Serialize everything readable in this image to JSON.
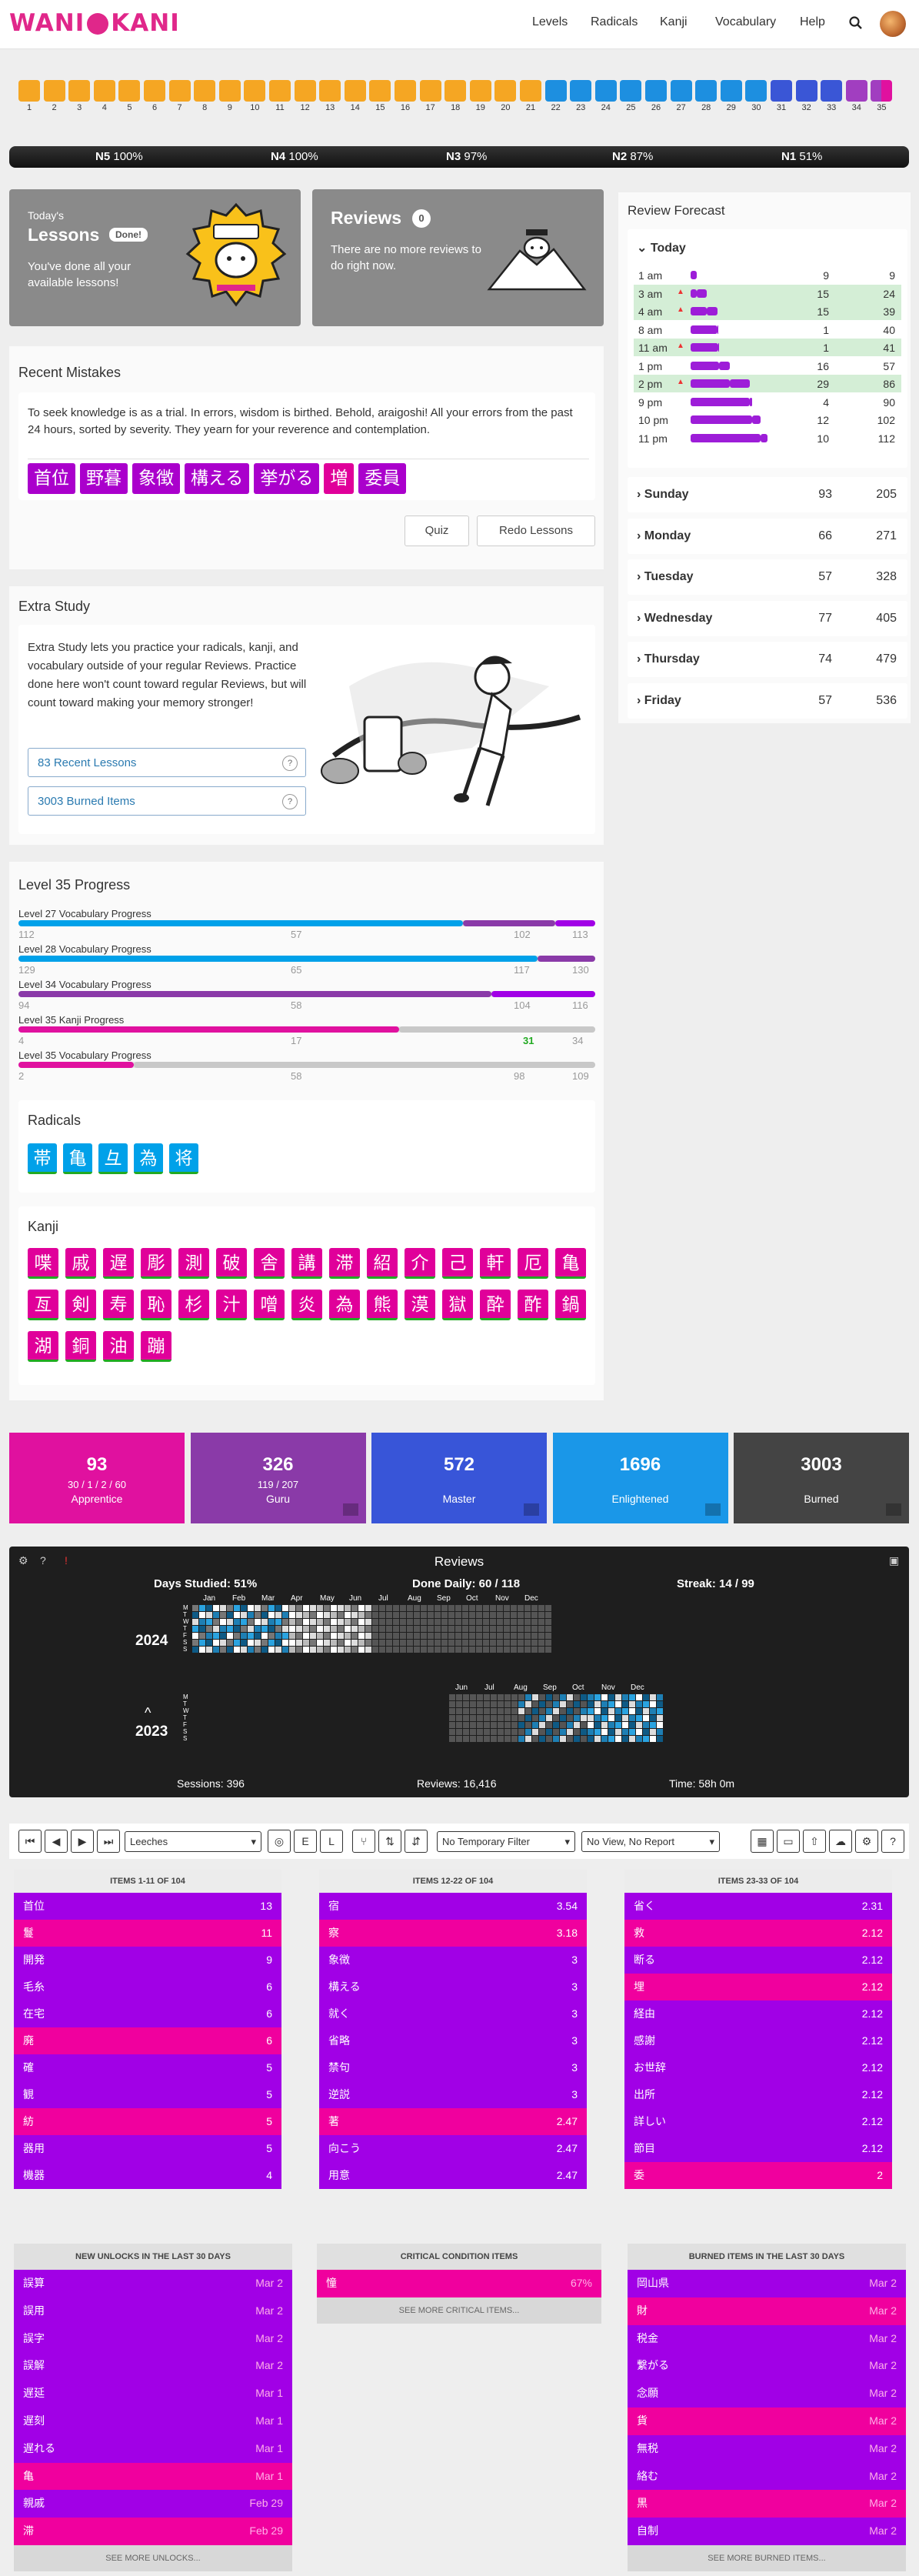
{
  "header": {
    "logo": "WANIKANI",
    "nav": [
      "Levels",
      "Radicals",
      "Kanji",
      "Vocabulary",
      "Help"
    ]
  },
  "levels": {
    "numbers": [
      "1",
      "2",
      "3",
      "4",
      "5",
      "6",
      "7",
      "8",
      "9",
      "10",
      "11",
      "12",
      "13",
      "14",
      "15",
      "16",
      "17",
      "18",
      "19",
      "20",
      "21",
      "22",
      "23",
      "24",
      "25",
      "26",
      "27",
      "28",
      "29",
      "30",
      "31",
      "32",
      "33",
      "34",
      "35"
    ]
  },
  "jlpt": [
    {
      "name": "N5",
      "pct": "100%"
    },
    {
      "name": "N4",
      "pct": "100%"
    },
    {
      "name": "N3",
      "pct": "97%"
    },
    {
      "name": "N2",
      "pct": "87%"
    },
    {
      "name": "N1",
      "pct": "51%"
    }
  ],
  "lessons": {
    "todays": "Today's",
    "title": "Lessons",
    "badge": "Done!",
    "text": "You've done all your available lessons!"
  },
  "reviews": {
    "title": "Reviews",
    "count": "0",
    "text": "There are no more reviews to do right now."
  },
  "mistakes": {
    "title": "Recent Mistakes",
    "text": "To seek knowledge is as a trial. In errors, wisdom is birthed. Behold, araigoshi! All your errors from the past 24 hours, sorted by severity. They yearn for your reverence and contemplation.",
    "items": [
      "首位",
      "野暮",
      "象徴",
      "構える",
      "挙がる",
      "増",
      "委員"
    ],
    "quiz": "Quiz",
    "redo": "Redo Lessons"
  },
  "extra": {
    "title": "Extra Study",
    "text": "Extra Study lets you practice your radicals, kanji, and vocabulary outside of your regular Reviews. Practice done here won't count toward regular Reviews, but will count toward making your memory stronger!",
    "recent": "83 Recent Lessons",
    "burned": "3003 Burned Items",
    "help": "?"
  },
  "progress": {
    "title": "Level 35 Progress",
    "bars": [
      {
        "label": "Level 27 Vocabulary Progress",
        "left": "112",
        "mid": "57",
        "mid2": "102",
        "right": "113"
      },
      {
        "label": "Level 28 Vocabulary Progress",
        "left": "129",
        "mid": "65",
        "mid2": "117",
        "right": "130"
      },
      {
        "label": "Level 34 Vocabulary Progress",
        "left": "94",
        "mid": "58",
        "mid2": "104",
        "right": "116"
      },
      {
        "label": "Level 35 Kanji Progress",
        "left": "4",
        "mid": "17",
        "mid2": "31",
        "right": "34"
      },
      {
        "label": "Level 35 Vocabulary Progress",
        "left": "2",
        "mid": "58",
        "mid2": "98",
        "right": "109"
      }
    ]
  },
  "radicals": {
    "title": "Radicals",
    "items": [
      "帯",
      "亀",
      "彑",
      "為",
      "将"
    ]
  },
  "kanji": {
    "title": "Kanji",
    "items": [
      "喋",
      "戚",
      "遅",
      "彫",
      "測",
      "破",
      "舎",
      "講",
      "滞",
      "紹",
      "介",
      "己",
      "軒",
      "厄",
      "亀",
      "亙",
      "剣",
      "寿",
      "恥",
      "杉",
      "汁",
      "噌",
      "炎",
      "為",
      "熊",
      "漠",
      "獄",
      "酔",
      "酢",
      "鍋",
      "湖",
      "銅",
      "油",
      "蹦"
    ]
  },
  "forecast": {
    "title": "Review Forecast",
    "today": "Today",
    "rows": [
      {
        "t": "1 am",
        "a": "9",
        "b": "9",
        "hl": false
      },
      {
        "t": "3 am",
        "a": "15",
        "b": "24",
        "hl": true
      },
      {
        "t": "4 am",
        "a": "15",
        "b": "39",
        "hl": true
      },
      {
        "t": "8 am",
        "a": "1",
        "b": "40",
        "hl": false
      },
      {
        "t": "11 am",
        "a": "1",
        "b": "41",
        "hl": true
      },
      {
        "t": "1 pm",
        "a": "16",
        "b": "57",
        "hl": false
      },
      {
        "t": "2 pm",
        "a": "29",
        "b": "86",
        "hl": true
      },
      {
        "t": "9 pm",
        "a": "4",
        "b": "90",
        "hl": false
      },
      {
        "t": "10 pm",
        "a": "12",
        "b": "102",
        "hl": false
      },
      {
        "t": "11 pm",
        "a": "10",
        "b": "112",
        "hl": false
      }
    ],
    "days": [
      {
        "d": "Sunday",
        "a": "93",
        "b": "205"
      },
      {
        "d": "Monday",
        "a": "66",
        "b": "271"
      },
      {
        "d": "Tuesday",
        "a": "57",
        "b": "328"
      },
      {
        "d": "Wednesday",
        "a": "77",
        "b": "405"
      },
      {
        "d": "Thursday",
        "a": "74",
        "b": "479"
      },
      {
        "d": "Friday",
        "a": "57",
        "b": "536"
      }
    ]
  },
  "totals": [
    {
      "n": "93",
      "s": "30 / 1 / 2 / 60",
      "l": "Apprentice",
      "color": "#e0119f"
    },
    {
      "n": "326",
      "s": "119 / 207",
      "l": "Guru",
      "color": "#8a3aa8"
    },
    {
      "n": "572",
      "s": "",
      "l": "Master",
      "color": "#3855d8"
    },
    {
      "n": "1696",
      "s": "",
      "l": "Enlightened",
      "color": "#1a97e8"
    },
    {
      "n": "3003",
      "s": "",
      "l": "Burned",
      "color": "#444444"
    }
  ],
  "heatmap": {
    "title": "Reviews",
    "days_studied": "Days Studied: 51%",
    "done_daily": "Done Daily: 60 / 118",
    "streak": "Streak: 14 / 99",
    "y2024": "2024",
    "y2023": "2023",
    "months2024": [
      "Jan",
      "Feb",
      "Mar",
      "Apr",
      "May",
      "Jun",
      "Jul",
      "Aug",
      "Sep",
      "Oct",
      "Nov",
      "Dec"
    ],
    "months2023": [
      "Jun",
      "Jul",
      "Aug",
      "Sep",
      "Oct",
      "Nov",
      "Dec"
    ],
    "sessions": "Sessions: 396",
    "reviews": "Reviews: 16,416",
    "time": "Time: 58h 0m",
    "weekdays": [
      "M",
      "T",
      "W",
      "T",
      "F",
      "S",
      "S"
    ]
  },
  "toolbar": {
    "preset": "Leeches",
    "filter": "No Temporary Filter",
    "view": "No View, No Report"
  },
  "lists": [
    {
      "head": "ITEMS 1-11 OF 104",
      "rows": [
        [
          "首位",
          "13",
          "p"
        ],
        [
          "鬘",
          "11",
          "k"
        ],
        [
          "開発",
          "9",
          "p"
        ],
        [
          "毛糸",
          "6",
          "p"
        ],
        [
          "在宅",
          "6",
          "p"
        ],
        [
          "廃",
          "6",
          "k"
        ],
        [
          "確",
          "5",
          "p"
        ],
        [
          "観",
          "5",
          "p"
        ],
        [
          "紡",
          "5",
          "k"
        ],
        [
          "器用",
          "5",
          "p"
        ],
        [
          "機器",
          "4",
          "p"
        ]
      ]
    },
    {
      "head": "ITEMS 12-22 OF 104",
      "rows": [
        [
          "宿",
          "3.54",
          "p"
        ],
        [
          "察",
          "3.18",
          "k"
        ],
        [
          "象徴",
          "3",
          "p"
        ],
        [
          "構える",
          "3",
          "p"
        ],
        [
          "就く",
          "3",
          "p"
        ],
        [
          "省略",
          "3",
          "p"
        ],
        [
          "禁句",
          "3",
          "p"
        ],
        [
          "逆説",
          "3",
          "p"
        ],
        [
          "著",
          "2.47",
          "k"
        ],
        [
          "向こう",
          "2.47",
          "p"
        ],
        [
          "用意",
          "2.47",
          "p"
        ]
      ]
    },
    {
      "head": "ITEMS 23-33 OF 104",
      "rows": [
        [
          "省く",
          "2.31",
          "p"
        ],
        [
          "救",
          "2.12",
          "k"
        ],
        [
          "断る",
          "2.12",
          "p"
        ],
        [
          "埋",
          "2.12",
          "k"
        ],
        [
          "経由",
          "2.12",
          "p"
        ],
        [
          "感謝",
          "2.12",
          "p"
        ],
        [
          "お世辞",
          "2.12",
          "p"
        ],
        [
          "出所",
          "2.12",
          "p"
        ],
        [
          "詳しい",
          "2.12",
          "p"
        ],
        [
          "節目",
          "2.12",
          "p"
        ],
        [
          "委",
          "2",
          "k"
        ]
      ]
    }
  ],
  "unlocks": {
    "head": "NEW UNLOCKS IN THE LAST 30 DAYS",
    "more": "SEE MORE UNLOCKS...",
    "rows": [
      [
        "誤算",
        "Mar 2",
        "p"
      ],
      [
        "誤用",
        "Mar 2",
        "p"
      ],
      [
        "誤字",
        "Mar 2",
        "p"
      ],
      [
        "誤解",
        "Mar 2",
        "p"
      ],
      [
        "遅延",
        "Mar 1",
        "p"
      ],
      [
        "遅刻",
        "Mar 1",
        "p"
      ],
      [
        "遅れる",
        "Mar 1",
        "p"
      ],
      [
        "亀",
        "Mar 1",
        "k"
      ],
      [
        "親戚",
        "Feb 29",
        "p"
      ],
      [
        "滞",
        "Feb 29",
        "k"
      ]
    ]
  },
  "critical": {
    "head": "CRITICAL CONDITION ITEMS",
    "more": "SEE MORE CRITICAL ITEMS...",
    "rows": [
      [
        "憧",
        "67%",
        "k"
      ]
    ]
  },
  "burned": {
    "head": "BURNED ITEMS IN THE LAST 30 DAYS",
    "more": "SEE MORE BURNED ITEMS...",
    "rows": [
      [
        "岡山県",
        "Mar 2",
        "p"
      ],
      [
        "財",
        "Mar 2",
        "k"
      ],
      [
        "税金",
        "Mar 2",
        "p"
      ],
      [
        "繋がる",
        "Mar 2",
        "p"
      ],
      [
        "念願",
        "Mar 2",
        "p"
      ],
      [
        "貨",
        "Mar 2",
        "k"
      ],
      [
        "無税",
        "Mar 2",
        "p"
      ],
      [
        "絡む",
        "Mar 2",
        "p"
      ],
      [
        "黒",
        "Mar 2",
        "k"
      ],
      [
        "自制",
        "Mar 2",
        "p"
      ]
    ]
  }
}
